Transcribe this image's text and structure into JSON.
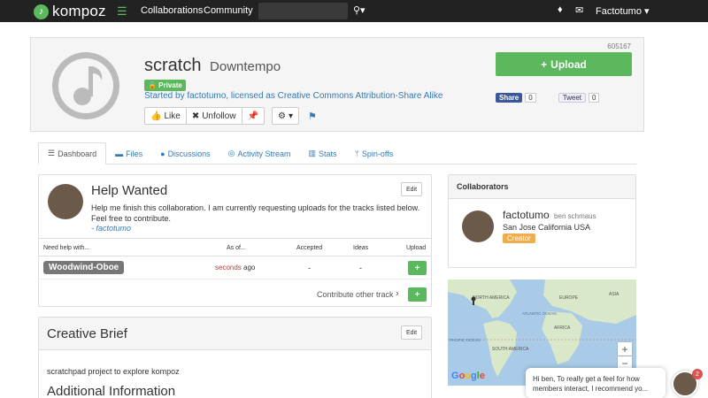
{
  "nav": {
    "logo_text": "kompoz",
    "collaborations": "Collaborations",
    "community": "Community",
    "search_placeholder": "",
    "user": "Factotumo ▾"
  },
  "project": {
    "number": "605167",
    "title": "scratch",
    "genre": "Downtempo",
    "private_badge": "🔒 Private",
    "started_text": "Started by factotumo, licensed as Creative Commons Attribution-Share Alike",
    "like_label": "Like",
    "unfollow_label": "Unfollow",
    "upload_label": "Upload",
    "fb_share": "Share",
    "fb_count": "0",
    "tweet": "Tweet",
    "tweet_count": "0"
  },
  "tabs": [
    {
      "label": "Dashboard",
      "icon": "list-icon"
    },
    {
      "label": "Files",
      "icon": "folder-icon"
    },
    {
      "label": "Discussions",
      "icon": "comments-icon"
    },
    {
      "label": "Activity Stream",
      "icon": "activity-icon"
    },
    {
      "label": "Stats",
      "icon": "bar-chart-icon"
    },
    {
      "label": "Spin-offs",
      "icon": "fork-icon"
    }
  ],
  "help": {
    "title": "Help Wanted",
    "text": "Help me finish this collaboration. I am currently requesting uploads for the tracks listed below. Feel free to contribute.",
    "author": "- factotumo",
    "edit": "Edit",
    "columns": [
      "Need help with...",
      "As of...",
      "Accepted",
      "Ideas",
      "Upload"
    ],
    "track": "Woodwind-Oboe",
    "as_of_red": "seconds",
    "as_of_rest": " ago",
    "accepted": "-",
    "ideas": "-",
    "contribute": "Contribute other track"
  },
  "brief": {
    "title": "Creative Brief",
    "edit": "Edit",
    "text": "scratchpad project to explore kompoz",
    "additional": "Additional Information"
  },
  "collaborators": {
    "header": "Collaborators",
    "name": "factotumo",
    "subname": "ben schmaus",
    "location": "San Jose California USA",
    "role": "Creator"
  },
  "map": {
    "labels": [
      "NORTH AMERICA",
      "EUROPE",
      "ATLANTIC OCEAN",
      "AFRICA",
      "SOUTH AMERICA",
      "PACIFIC OCEAN",
      "ASIA"
    ],
    "google": "Google",
    "zoom_in": "+",
    "zoom_out": "−"
  },
  "chat": {
    "message": "Hi ben, To really get a feel for how members interact, I recommend yo...",
    "count": "2"
  },
  "colors": {
    "green": "#5cb85c",
    "link": "#337ab7",
    "orange": "#f0ad4e",
    "navbar": "#222222"
  }
}
